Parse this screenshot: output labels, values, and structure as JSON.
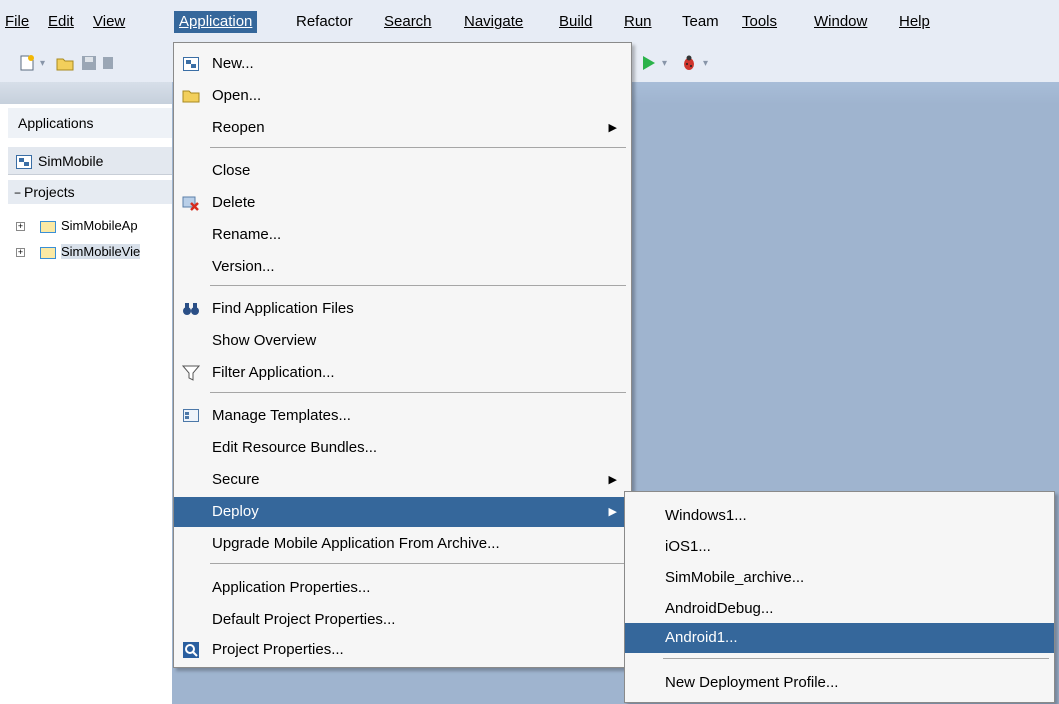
{
  "menubar": {
    "items": [
      {
        "label": "File"
      },
      {
        "label": "Edit"
      },
      {
        "label": "View"
      },
      {
        "label": "Application"
      },
      {
        "label": "Refactor"
      },
      {
        "label": "Search"
      },
      {
        "label": "Navigate"
      },
      {
        "label": "Build"
      },
      {
        "label": "Run"
      },
      {
        "label": "Team"
      },
      {
        "label": "Tools"
      },
      {
        "label": "Window"
      },
      {
        "label": "Help"
      }
    ]
  },
  "left_panel": {
    "title": "Applications",
    "app_selector": "SimMobile",
    "projects_label": "Projects",
    "tree": [
      {
        "label": "SimMobileAp"
      },
      {
        "label": "SimMobileVie"
      }
    ]
  },
  "app_menu": {
    "items": [
      {
        "label": "New...",
        "icon": "new-application-icon"
      },
      {
        "label": "Open...",
        "icon": "open-folder-icon"
      },
      {
        "label": "Reopen",
        "submenu": true
      },
      {
        "label": "Close"
      },
      {
        "label": "Delete",
        "icon": "delete-icon"
      },
      {
        "label": "Rename..."
      },
      {
        "label": "Version..."
      },
      {
        "label": "Find Application Files",
        "icon": "binoculars-icon"
      },
      {
        "label": "Show Overview"
      },
      {
        "label": "Filter Application...",
        "icon": "filter-icon"
      },
      {
        "label": "Manage Templates...",
        "icon": "templates-icon"
      },
      {
        "label": "Edit Resource Bundles..."
      },
      {
        "label": "Secure",
        "submenu": true
      },
      {
        "label": "Deploy",
        "submenu": true,
        "highlighted": true
      },
      {
        "label": "Upgrade Mobile Application From Archive..."
      },
      {
        "label": "Application Properties..."
      },
      {
        "label": "Default Project Properties..."
      },
      {
        "label": "Project Properties...",
        "icon": "project-properties-icon"
      }
    ]
  },
  "deploy_menu": {
    "items": [
      {
        "label": "Windows1..."
      },
      {
        "label": "iOS1..."
      },
      {
        "label": "SimMobile_archive..."
      },
      {
        "label": "AndroidDebug..."
      },
      {
        "label": "Android1...",
        "highlighted": true
      },
      {
        "label": "New Deployment Profile..."
      }
    ]
  },
  "colors": {
    "highlight": "#35679b",
    "workspace": "#9fb4cf",
    "menu_bg": "#f6f6f6"
  }
}
